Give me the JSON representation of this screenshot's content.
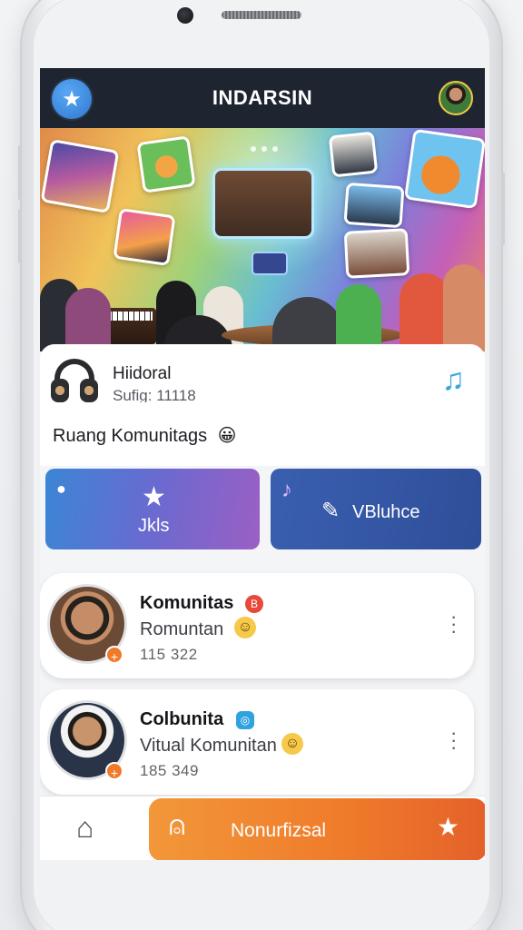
{
  "header": {
    "title": "INDARSIN",
    "menu_icon": "star-icon",
    "profile_icon": "avatar"
  },
  "hero": {
    "carousel_pages": 3,
    "active_page": 1
  },
  "now_playing": {
    "title": "Hiidoral",
    "subtitle": "Sufig: 11118",
    "icon": "music-note-icon"
  },
  "section": {
    "label": "Ruang Komunitags",
    "emoji": "😀"
  },
  "actions": [
    {
      "label": "Jkls",
      "icon": "star-icon",
      "corner_icon": "person-icon"
    },
    {
      "label": "VBluhce",
      "icon": "tag-icon",
      "corner_icon": "music-note-icon"
    }
  ],
  "communities": [
    {
      "name": "Komunitas",
      "desc": "Romuntan",
      "count": "115 322",
      "badge_color": "#e54a3a",
      "emoji": "😀"
    },
    {
      "name": "Colbunita",
      "desc": "Vitual Komunitan",
      "count": "185 349",
      "badge_color": "#2fa3df",
      "emoji": "😀"
    }
  ],
  "bottom_nav": {
    "home_icon": "home-icon",
    "cta_label": "Nonurfizsal",
    "cta_left_icon": "bell-icon",
    "cta_right_icon": "star-icon"
  },
  "colors": {
    "topbar": "#1e2530",
    "accent_blue": "#2e7bd7",
    "cta_orange": "#ef7a2a"
  }
}
